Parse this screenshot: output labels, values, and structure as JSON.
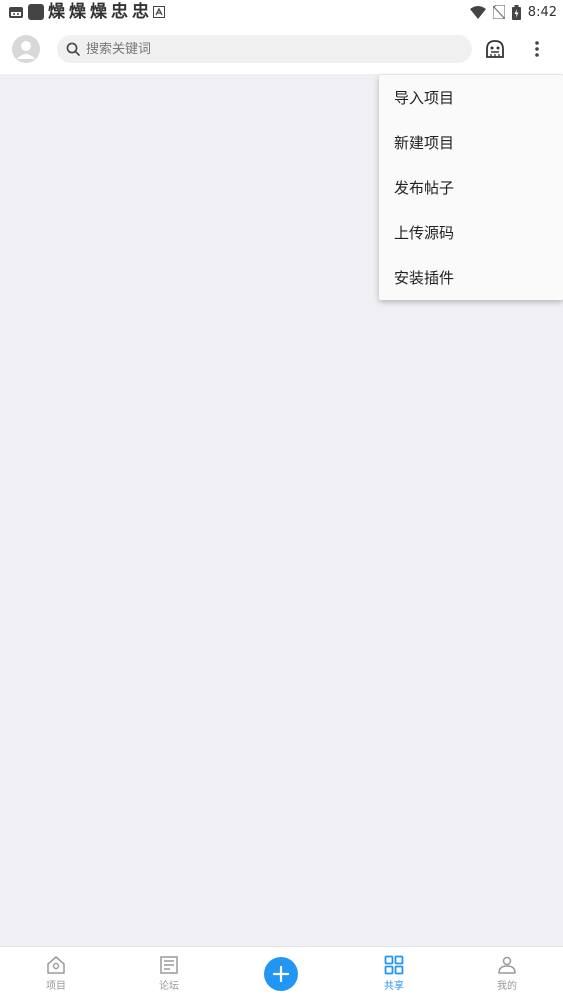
{
  "status_bar": {
    "notification_glyphs": [
      "燥",
      "燥",
      "燥",
      "忠",
      "忠"
    ],
    "time": "8:42"
  },
  "app_bar": {
    "search_placeholder": "搜索关键词",
    "icons": [
      "avatar",
      "search-icon",
      "bot-icon",
      "more-vert-icon"
    ]
  },
  "menu": {
    "items": [
      {
        "label": "导入项目"
      },
      {
        "label": "新建项目"
      },
      {
        "label": "发布帖子"
      },
      {
        "label": "上传源码"
      },
      {
        "label": "安装插件"
      }
    ]
  },
  "bottom_nav": {
    "items": [
      {
        "label": "项目",
        "icon": "home-icon",
        "active": false
      },
      {
        "label": "论坛",
        "icon": "forum-icon",
        "active": false
      },
      {
        "label": "共享",
        "icon": "share-grid-icon",
        "active": true
      },
      {
        "label": "我的",
        "icon": "profile-icon",
        "active": false
      }
    ],
    "add_icon": "plus-icon"
  },
  "colors": {
    "accent": "#2196f3",
    "background": "#efeff4",
    "inactive": "#9a9a9a"
  }
}
